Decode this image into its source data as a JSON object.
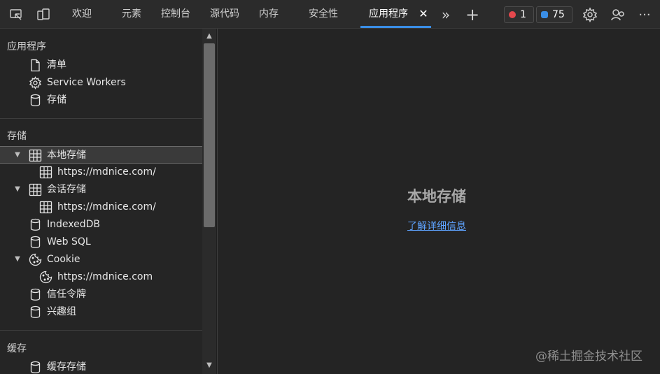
{
  "toolbar": {
    "inspect_icon": "inspect-icon",
    "device_icon": "device-emulation-icon",
    "tabs": [
      {
        "label": "欢迎"
      },
      {
        "label": "元素"
      },
      {
        "label": "控制台"
      },
      {
        "label": "源代码"
      },
      {
        "label": "内存"
      },
      {
        "label": "安全性"
      },
      {
        "label": "应用程序",
        "active": true
      }
    ],
    "close_glyph": "✕",
    "more_tabs_glyph": "»",
    "add_tab_glyph": "+",
    "errors_count": "1",
    "issues_count": "75",
    "more_glyph": "···",
    "colors": {
      "error": "#e5484d",
      "issue": "#3a8ee6",
      "accent": "#3a8ee6"
    }
  },
  "sidebar": {
    "app_section": {
      "header": "应用程序",
      "items": [
        {
          "label": "清单",
          "icon": "file-icon"
        },
        {
          "label": "Service Workers",
          "icon": "gear-icon"
        },
        {
          "label": "存储",
          "icon": "database-icon"
        }
      ]
    },
    "storage_section": {
      "header": "存储",
      "items": [
        {
          "label": "本地存储",
          "icon": "grid-icon",
          "expanded": true,
          "selected": true
        },
        {
          "label": "https://mdnice.com/",
          "icon": "grid-icon",
          "child": true
        },
        {
          "label": "会话存储",
          "icon": "grid-icon",
          "expanded": true
        },
        {
          "label": "https://mdnice.com/",
          "icon": "grid-icon",
          "child": true
        },
        {
          "label": "IndexedDB",
          "icon": "database-icon"
        },
        {
          "label": "Web SQL",
          "icon": "database-icon"
        },
        {
          "label": "Cookie",
          "icon": "cookie-icon",
          "expanded": true
        },
        {
          "label": "https://mdnice.com",
          "icon": "cookie-icon",
          "child": true
        },
        {
          "label": "信任令牌",
          "icon": "database-icon"
        },
        {
          "label": "兴趣组",
          "icon": "database-icon"
        }
      ]
    },
    "cache_section": {
      "header": "缓存",
      "items": [
        {
          "label": "缓存存储",
          "icon": "database-icon"
        }
      ]
    }
  },
  "main": {
    "title": "本地存储",
    "link": "了解详细信息"
  },
  "watermark": "@稀土掘金技术社区"
}
